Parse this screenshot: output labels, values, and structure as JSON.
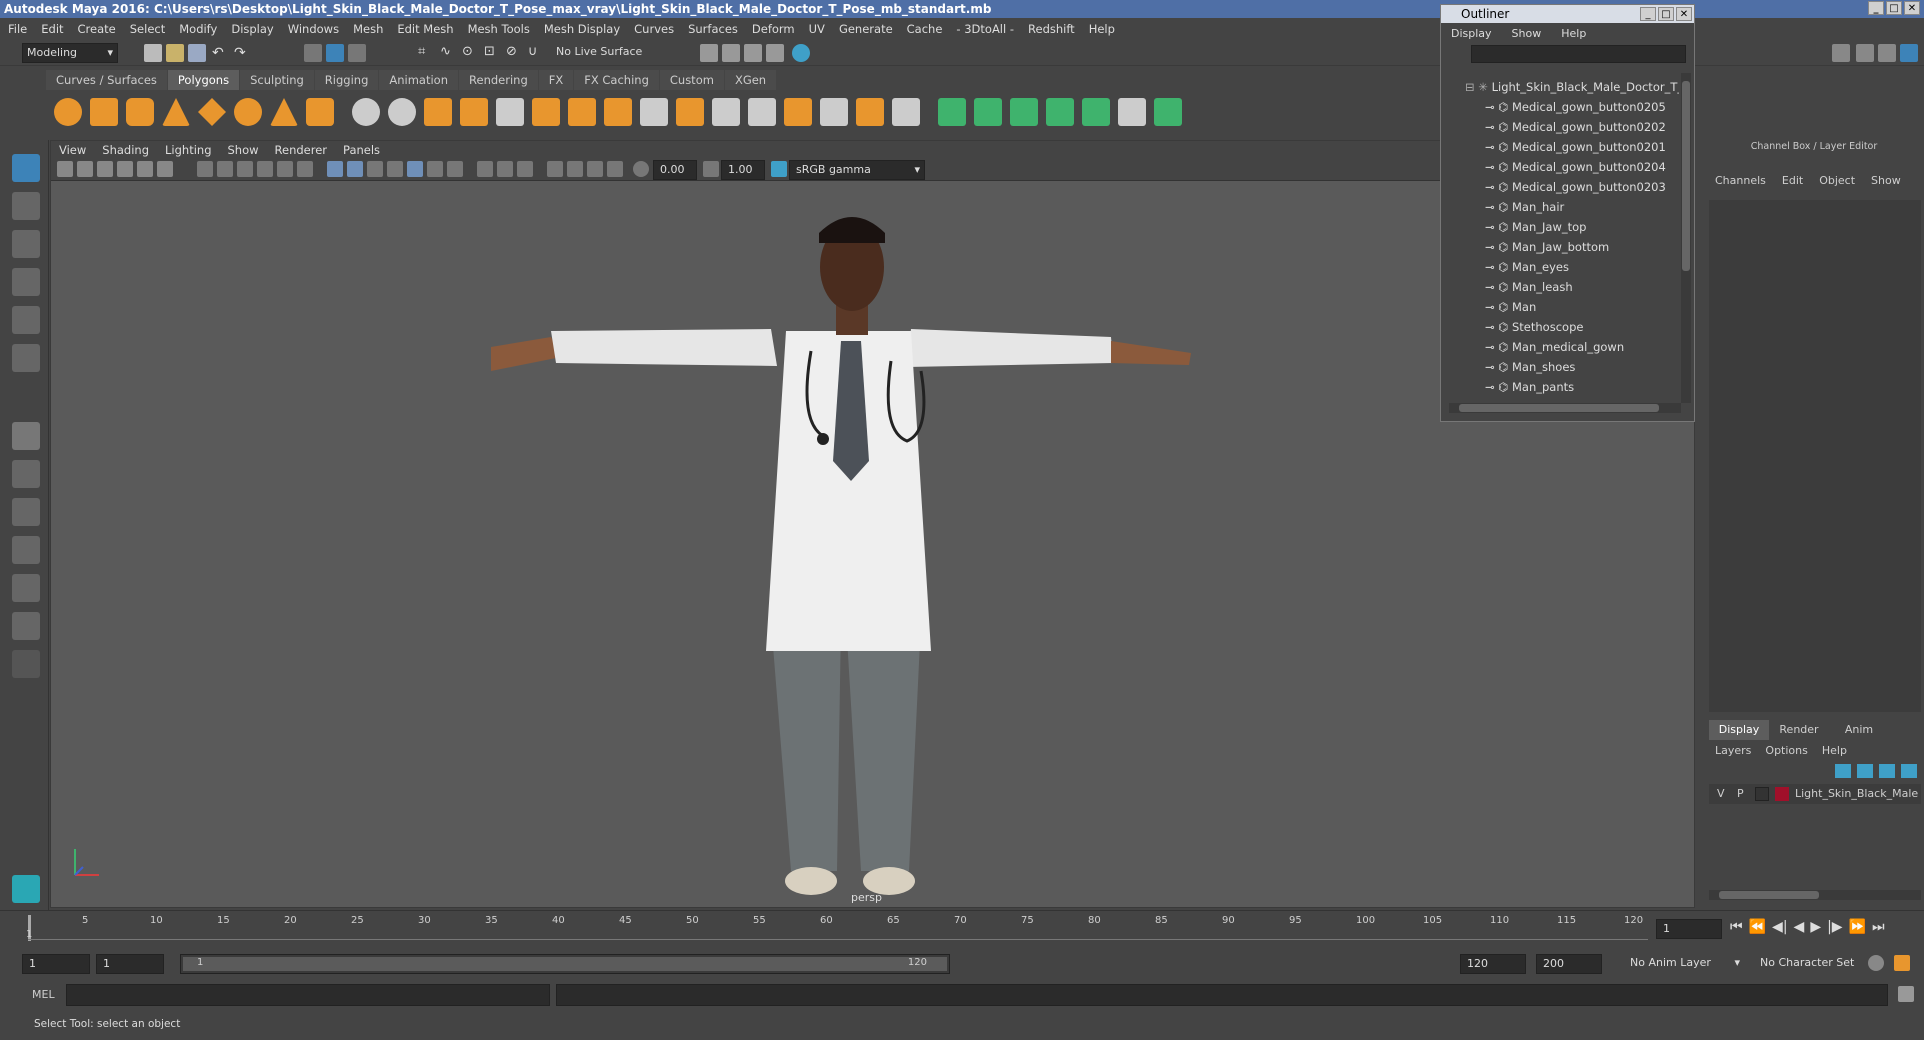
{
  "window": {
    "title": "Autodesk Maya 2016: C:\\Users\\rs\\Desktop\\Light_Skin_Black_Male_Doctor_T_Pose_max_vray\\Light_Skin_Black_Male_Doctor_T_Pose_mb_standart.mb"
  },
  "menu": [
    "File",
    "Edit",
    "Create",
    "Select",
    "Modify",
    "Display",
    "Windows",
    "Mesh",
    "Edit Mesh",
    "Mesh Tools",
    "Mesh Display",
    "Curves",
    "Surfaces",
    "Deform",
    "UV",
    "Generate",
    "Cache",
    "- 3DtoAll -",
    "Redshift",
    "Help"
  ],
  "toolbar": {
    "mode": "Modeling",
    "live_surface": "No Live Surface"
  },
  "shelf_tabs": [
    "Curves / Surfaces",
    "Polygons",
    "Sculpting",
    "Rigging",
    "Animation",
    "Rendering",
    "FX",
    "FX Caching",
    "Custom",
    "XGen"
  ],
  "shelf_active": "Polygons",
  "viewport": {
    "menu": [
      "View",
      "Shading",
      "Lighting",
      "Show",
      "Renderer",
      "Panels"
    ],
    "exposure": "0.00",
    "gamma": "1.00",
    "color_space": "sRGB gamma",
    "camera_label": "persp"
  },
  "outliner": {
    "title": "Outliner",
    "menu": [
      "Display",
      "Show",
      "Help"
    ],
    "root": "Light_Skin_Black_Male_Doctor_T_",
    "items": [
      "Medical_gown_button0205",
      "Medical_gown_button0202",
      "Medical_gown_button0201",
      "Medical_gown_button0204",
      "Medical_gown_button0203",
      "Man_hair",
      "Man_Jaw_top",
      "Man_Jaw_bottom",
      "Man_eyes",
      "Man_leash",
      "Man",
      "Stethoscope",
      "Man_medical_gown",
      "Man_shoes",
      "Man_pants"
    ]
  },
  "channel_box": {
    "title": "Channel Box / Layer Editor",
    "menu": [
      "Channels",
      "Edit",
      "Object",
      "Show"
    ],
    "layer_tabs": [
      "Display",
      "Render",
      "Anim"
    ],
    "layer_menu": [
      "Layers",
      "Options",
      "Help"
    ],
    "layer": {
      "v": "V",
      "p": "P",
      "name": "Light_Skin_Black_Male",
      "color": "#a0102a"
    }
  },
  "timeline": {
    "ticks": [
      "5",
      "10",
      "15",
      "20",
      "25",
      "30",
      "35",
      "40",
      "45",
      "50",
      "55",
      "60",
      "65",
      "70",
      "75",
      "80",
      "85",
      "90",
      "95",
      "100",
      "105",
      "110",
      "115",
      "120"
    ],
    "current_frame": "1"
  },
  "range": {
    "start": "1",
    "anim_start": "1",
    "slider_start": "1",
    "slider_end": "120",
    "anim_end": "120",
    "end": "200",
    "anim_layer": "No Anim Layer",
    "char_set": "No Character Set"
  },
  "cmd": {
    "lang": "MEL"
  },
  "status": {
    "text": "Select Tool: select an object"
  },
  "colors": {
    "accent": "#4f6fa6",
    "shelf_orange": "#e8962e",
    "shelf_green": "#3fb36d"
  }
}
